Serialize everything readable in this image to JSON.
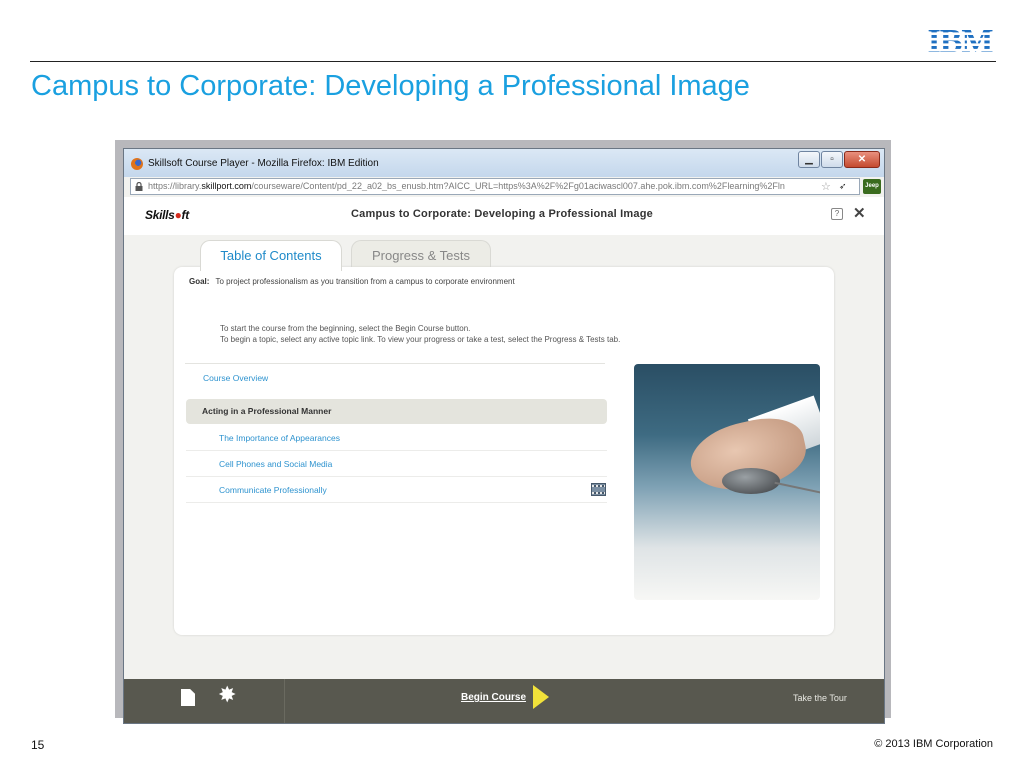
{
  "slide": {
    "title": "Campus to Corporate: Developing a Professional Image",
    "logo": "IBM",
    "page_number": "15",
    "copyright": "© 2013 IBM Corporation"
  },
  "browser": {
    "window_title": "Skillsoft Course Player - Mozilla Firefox: IBM Edition",
    "url_prefix": "https://library.",
    "url_domain": "skillport.com",
    "url_rest": "/courseware/Content/pd_22_a02_bs_enusb.htm?AICC_URL=https%3A%2F%2Fg01aciwascl007.ahe.pok.ibm.com%2Flearning%2Fln",
    "addon_badge": "Jeep"
  },
  "player": {
    "logo_text": "Skillsoft",
    "logo_prefix": "Skills",
    "logo_suffix": "ft",
    "course_title": "Campus to Corporate: Developing a Professional Image",
    "help_label": "?",
    "close_label": "✕",
    "tabs": [
      {
        "label": "Table of Contents",
        "active": true
      },
      {
        "label": "Progress & Tests",
        "active": false
      }
    ],
    "goal_label": "Goal:",
    "goal_text": "To project professionalism as you transition from a campus to corporate environment",
    "instructions": [
      "To start the course from the beginning, select the Begin Course button.",
      "To begin a topic, select any active topic link. To view your progress or take a test, select the Progress & Tests tab."
    ],
    "course_overview": "Course Overview",
    "section_title": "Acting in a Professional Manner",
    "topics": [
      {
        "label": "The Importance of Appearances"
      },
      {
        "label": "Cell Phones and Social Media"
      },
      {
        "label": "Communicate Professionally",
        "icon": "film-icon"
      }
    ],
    "footer": {
      "begin_course": "Begin Course",
      "take_tour": "Take the Tour"
    }
  },
  "colors": {
    "title_blue": "#1aa0e0",
    "link_blue": "#2e93cf",
    "footer_bar": "#58584f",
    "play_yellow": "#f2e23a"
  }
}
